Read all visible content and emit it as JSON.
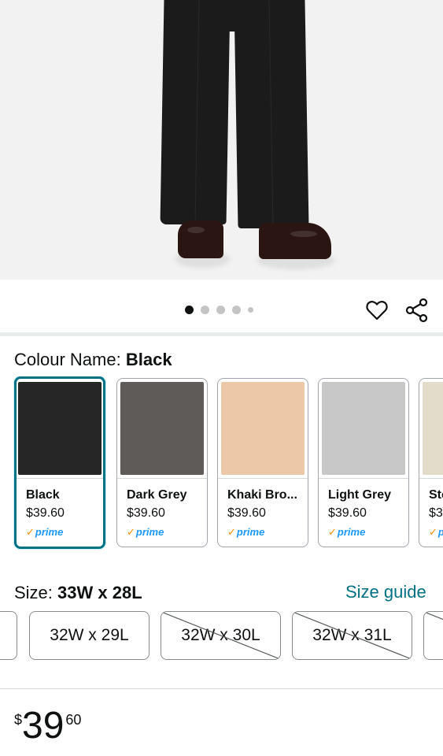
{
  "product_image": {
    "pager_total": 5,
    "pager_active": 1
  },
  "colour": {
    "label": "Colour Name:",
    "selected": "Black",
    "options": [
      {
        "name": "Black",
        "price": "$39.60",
        "badge": "prime",
        "swatch": "#262626",
        "selected": true
      },
      {
        "name": "Dark Grey",
        "price": "$39.60",
        "badge": "prime",
        "swatch": "#5e5b58",
        "selected": false
      },
      {
        "name": "Khaki Bro...",
        "price": "$39.60",
        "badge": "prime",
        "swatch": "#ecc8a8",
        "selected": false
      },
      {
        "name": "Light Grey",
        "price": "$39.60",
        "badge": "prime",
        "swatch": "#c8c8c8",
        "selected": false
      },
      {
        "name": "Sto",
        "price": "$3",
        "badge": "pr",
        "swatch": "#e3dccb",
        "selected": false
      }
    ]
  },
  "size": {
    "label": "Size:",
    "selected": "33W x 28L",
    "guide_label": "Size guide",
    "options": [
      {
        "label": "",
        "available": true
      },
      {
        "label": "32W x 29L",
        "available": true
      },
      {
        "label": "32W x 30L",
        "available": false
      },
      {
        "label": "32W x 31L",
        "available": false
      },
      {
        "label": "",
        "available": false
      }
    ]
  },
  "price": {
    "currency": "$",
    "whole": "39",
    "fraction": "60"
  },
  "icons": {
    "wishlist": "heart-icon",
    "share": "share-icon",
    "prime_check": "check-icon"
  },
  "colors": {
    "link": "#007185",
    "selected_border": "#007185",
    "prime_blue": "#1a98ff",
    "prime_check": "#f08804"
  }
}
